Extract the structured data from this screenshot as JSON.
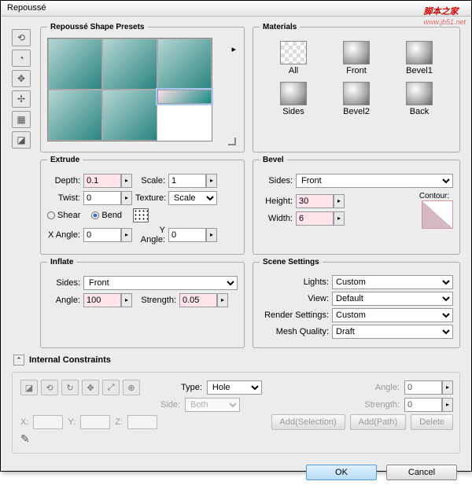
{
  "title": "Repoussé",
  "watermark": {
    "t": "脚本之家",
    "u": "www.jb51.net"
  },
  "presets": {
    "legend": "Repoussé Shape Presets"
  },
  "materials": {
    "legend": "Materials",
    "items": [
      "All",
      "Front",
      "Bevel1",
      "Sides",
      "Bevel2",
      "Back"
    ]
  },
  "extrude": {
    "legend": "Extrude",
    "depth_l": "Depth:",
    "depth": "0.1",
    "scale_l": "Scale:",
    "scale": "1",
    "twist_l": "Twist:",
    "twist": "0",
    "tex_l": "Texture:",
    "tex": "Scale",
    "shear": "Shear",
    "bend": "Bend",
    "xa_l": "X Angle:",
    "xa": "0",
    "ya_l": "Y Angle:",
    "ya": "0"
  },
  "bevel": {
    "legend": "Bevel",
    "sides_l": "Sides:",
    "sides": "Front",
    "height_l": "Height:",
    "height": "30",
    "width_l": "Width:",
    "width": "6",
    "contour_l": "Contour:"
  },
  "inflate": {
    "legend": "Inflate",
    "sides_l": "Sides:",
    "sides": "Front",
    "angle_l": "Angle:",
    "angle": "100",
    "str_l": "Strength:",
    "str": "0.05"
  },
  "scene": {
    "legend": "Scene Settings",
    "lights_l": "Lights:",
    "lights": "Custom",
    "view_l": "View:",
    "view": "Default",
    "render_l": "Render Settings:",
    "render": "Custom",
    "mesh_l": "Mesh Quality:",
    "mesh": "Draft"
  },
  "ic": {
    "legend": "Internal Constraints",
    "type_l": "Type:",
    "type": "Hole",
    "side_l": "Side:",
    "side": "Both",
    "angle_l": "Angle:",
    "angle": "0",
    "str_l": "Strength:",
    "str": "0",
    "addsel": "Add(Selection)",
    "addpath": "Add(Path)",
    "del": "Delete",
    "x": "X:",
    "y": "Y:",
    "z": "Z:"
  },
  "ok": "OK",
  "cancel": "Cancel"
}
